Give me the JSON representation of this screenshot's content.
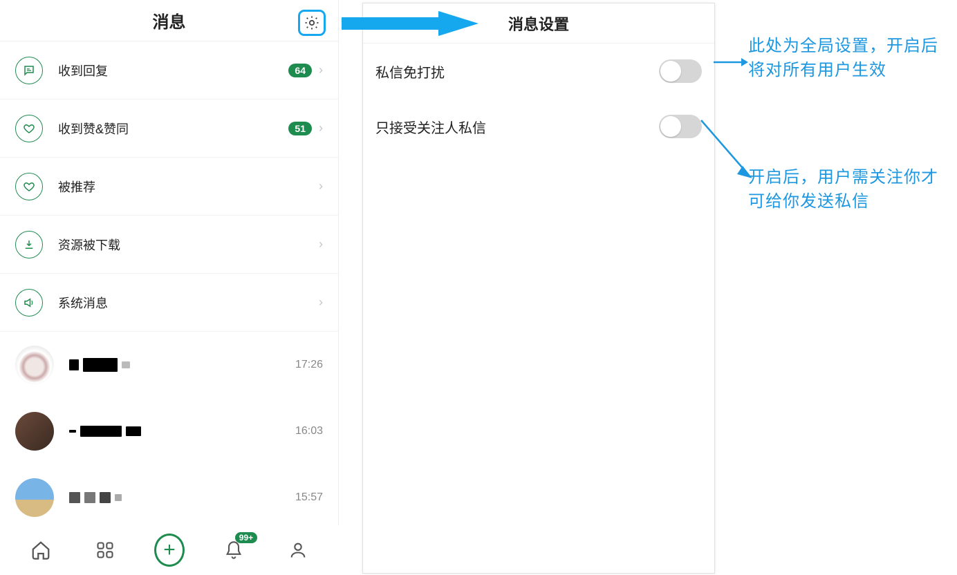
{
  "left": {
    "title": "消息",
    "categories": [
      {
        "icon": "chat",
        "label": "收到回复",
        "badge": "64"
      },
      {
        "icon": "heart",
        "label": "收到赞&赞同",
        "badge": "51"
      },
      {
        "icon": "heart",
        "label": "被推荐",
        "badge": null
      },
      {
        "icon": "download",
        "label": "资源被下载",
        "badge": null
      },
      {
        "icon": "speaker",
        "label": "系统消息",
        "badge": null
      }
    ],
    "conversations": [
      {
        "time": "17:26"
      },
      {
        "time": "16:03"
      },
      {
        "time": "15:57"
      }
    ],
    "nav_badge": "99+"
  },
  "settings": {
    "title": "消息设置",
    "rows": [
      {
        "label": "私信免打扰",
        "on": false
      },
      {
        "label": "只接受关注人私信",
        "on": false
      }
    ]
  },
  "annotations": {
    "a1": "此处为全局设置，开启后将对所有用户生效",
    "a2": "开启后，用户需关注你才可给你发送私信"
  }
}
